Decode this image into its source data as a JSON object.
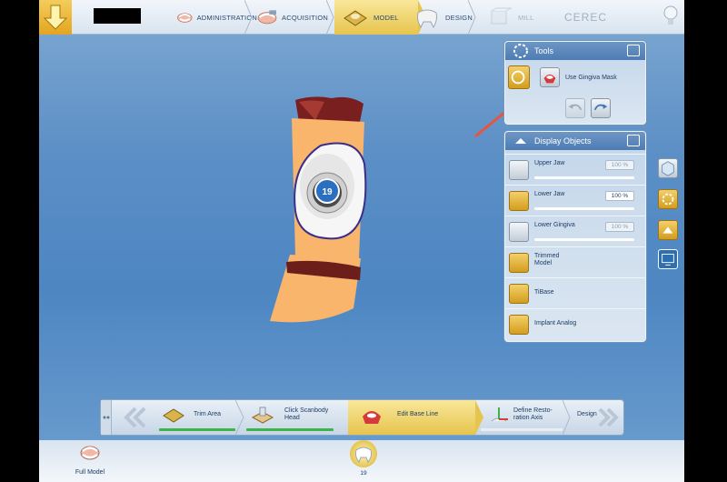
{
  "workflow": {
    "steps": [
      {
        "label": "ADMINISTRATION"
      },
      {
        "label": "ACQUISITION"
      },
      {
        "label": "MODEL"
      },
      {
        "label": "DESIGN"
      },
      {
        "label": "MILL"
      }
    ],
    "active_step": "MODEL",
    "brand": "CEREC"
  },
  "tools_panel": {
    "title": "Tools",
    "tool_label": "Use Gingiva Mask"
  },
  "display_objects": {
    "title": "Display Objects",
    "items": [
      {
        "label": "Upper Jaw",
        "percent": "100 %",
        "active": false,
        "opacity": 1.0
      },
      {
        "label": "Lower Jaw",
        "percent": "100 %",
        "active": true,
        "opacity": 1.0
      },
      {
        "label": "Lower Gingiva",
        "percent": "100 %",
        "active": false,
        "opacity": 1.0
      },
      {
        "label": "Trimmed Model",
        "active": true
      },
      {
        "label": "TiBase",
        "active": true
      },
      {
        "label": "Implant Analog",
        "active": true
      }
    ]
  },
  "model_view": {
    "tooth_number": "19"
  },
  "phases": [
    {
      "label": "Trim Area",
      "status": "done"
    },
    {
      "label": "Click Scanbody Head",
      "status": "done"
    },
    {
      "label": "Edit Base Line",
      "status": "current"
    },
    {
      "label": "Define Resto-ration Axis",
      "status": "pending"
    },
    {
      "label": "Design",
      "status": "next"
    }
  ],
  "bottom_bar": {
    "model_label": "Full Model",
    "tooth_number": "19"
  },
  "colors": {
    "accent_gold": "#e6c44d",
    "panel_header": "#4d7cb4",
    "progress_green": "#3fb34a",
    "highlight_red": "#e8543f"
  }
}
